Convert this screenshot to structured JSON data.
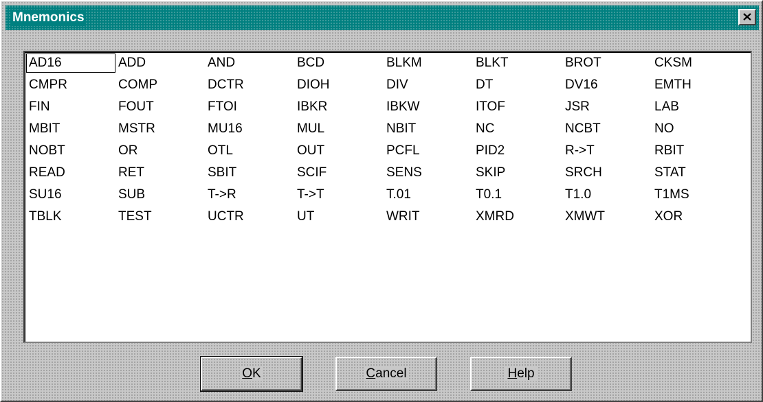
{
  "window": {
    "title": "Mnemonics"
  },
  "colors": {
    "titlebar": "#008080",
    "face": "#c0c0c0",
    "list_bg": "#ffffff"
  },
  "icons": {
    "close": "close-x-icon"
  },
  "list": {
    "focused_item": "AD16",
    "items": [
      "AD16",
      "ADD",
      "AND",
      "BCD",
      "BLKM",
      "BLKT",
      "BROT",
      "CKSM",
      "CMPR",
      "COMP",
      "DCTR",
      "DIOH",
      "DIV",
      "DT",
      "DV16",
      "EMTH",
      "FIN",
      "FOUT",
      "FTOI",
      "IBKR",
      "IBKW",
      "ITOF",
      "JSR",
      "LAB",
      "MBIT",
      "MSTR",
      "MU16",
      "MUL",
      "NBIT",
      "NC",
      "NCBT",
      "NO",
      "NOBT",
      "OR",
      "OTL",
      "OUT",
      "PCFL",
      "PID2",
      "R->T",
      "RBIT",
      "READ",
      "RET",
      "SBIT",
      "SCIF",
      "SENS",
      "SKIP",
      "SRCH",
      "STAT",
      "SU16",
      "SUB",
      "T->R",
      "T->T",
      "T.01",
      "T0.1",
      "T1.0",
      "T1MS",
      "TBLK",
      "TEST",
      "UCTR",
      "UT",
      "WRIT",
      "XMRD",
      "XMWT",
      "XOR"
    ]
  },
  "buttons": {
    "ok": {
      "accel": "O",
      "rest": "K"
    },
    "cancel": {
      "accel": "C",
      "rest": "ancel"
    },
    "help": {
      "accel": "H",
      "rest": "elp"
    }
  }
}
